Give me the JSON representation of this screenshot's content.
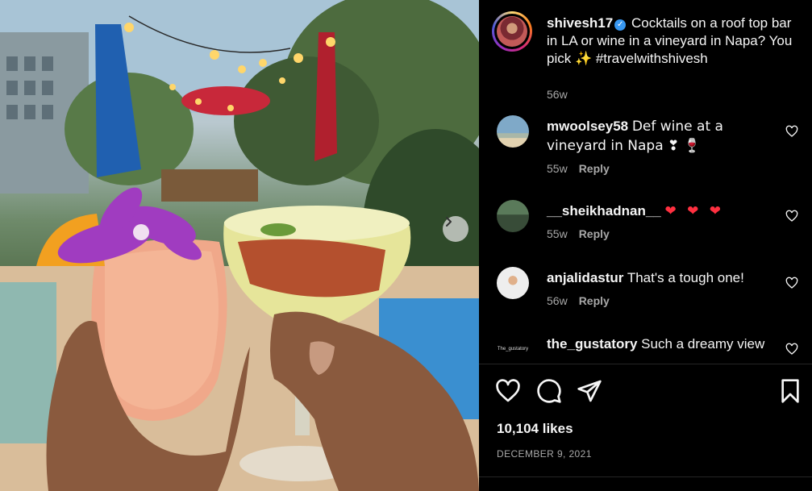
{
  "post": {
    "image_alt": "Two cocktails toasting on a rooftop bar",
    "icons": {
      "next": "chevron-right-icon"
    }
  },
  "caption": {
    "username": "shivesh17",
    "verified": true,
    "text": "Cocktails on a roof top bar in LA or wine in a vineyard in Napa? You pick ✨ #travelwithshivesh",
    "time": "56w"
  },
  "comments": [
    {
      "username": "mwoolsey58",
      "text": "Def wine at a vineyard in Napa ❣ 🍷",
      "time": "55w",
      "reply": "Reply"
    },
    {
      "username": "__sheikhadnan__",
      "text": "❤ ❤ ❤",
      "time": "55w",
      "reply": "Reply"
    },
    {
      "username": "anjalidastur",
      "text": "That's a tough one!",
      "time": "56w",
      "reply": "Reply"
    },
    {
      "username": "the_gustatory",
      "text": "Such a dreamy view",
      "time": "",
      "reply": "",
      "avatar_text": "The_gustatory"
    }
  ],
  "actions": {
    "icons": [
      "heart-icon",
      "comment-icon",
      "share-icon",
      "bookmark-icon"
    ]
  },
  "likes": "10,104 likes",
  "date": "DECEMBER 9, 2021",
  "colors": {
    "background": "#000000",
    "text": "#f5f5f5",
    "muted": "#a8a8a8",
    "verified": "#3897f0",
    "heart_red": "#ff3040"
  }
}
